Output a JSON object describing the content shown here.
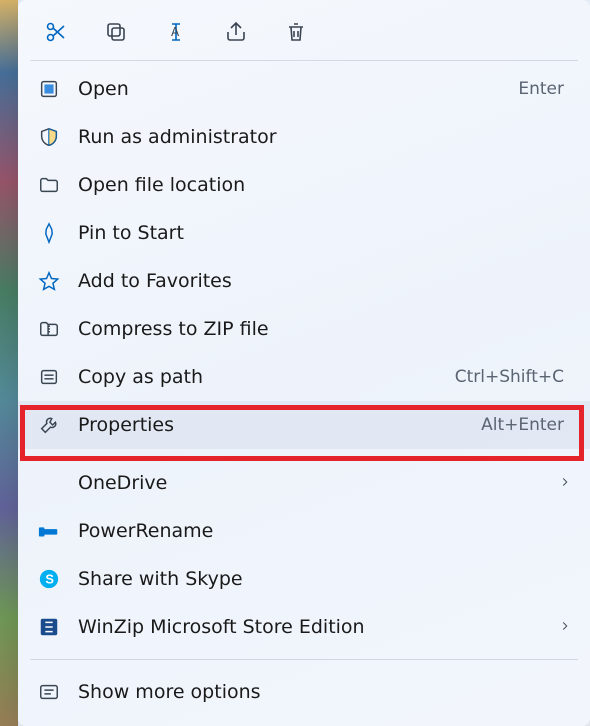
{
  "toolbar": {
    "cut": "cut",
    "copy": "copy",
    "rename": "rename",
    "share": "share",
    "delete": "delete"
  },
  "menu": {
    "open": {
      "label": "Open",
      "shortcut": "Enter"
    },
    "runadmin": {
      "label": "Run as administrator"
    },
    "openloc": {
      "label": "Open file location"
    },
    "pin": {
      "label": "Pin to Start"
    },
    "fav": {
      "label": "Add to Favorites"
    },
    "zip": {
      "label": "Compress to ZIP file"
    },
    "copypath": {
      "label": "Copy as path",
      "shortcut": "Ctrl+Shift+C"
    },
    "properties": {
      "label": "Properties",
      "shortcut": "Alt+Enter"
    },
    "onedrive": {
      "label": "OneDrive"
    },
    "powerrename": {
      "label": "PowerRename"
    },
    "skype": {
      "label": "Share with Skype"
    },
    "winzip": {
      "label": "WinZip Microsoft Store Edition"
    },
    "more": {
      "label": "Show more options"
    }
  }
}
